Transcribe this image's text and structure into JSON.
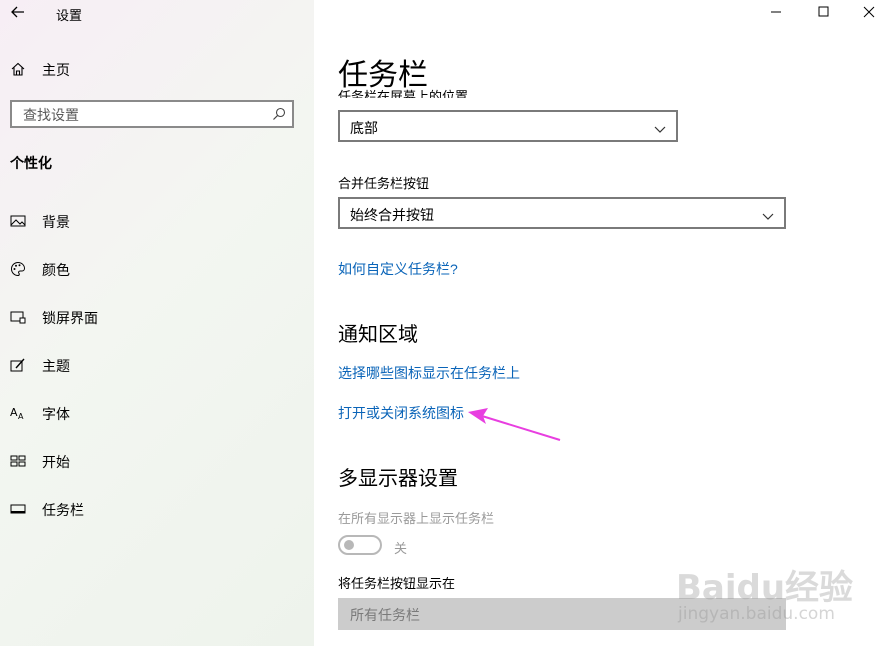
{
  "window": {
    "app_title": "设置",
    "controls": [
      "minimize-icon",
      "maximize-icon",
      "close-icon"
    ]
  },
  "sidebar": {
    "home_label": "主页",
    "search_placeholder": "查找设置",
    "section_title": "个性化",
    "items": [
      {
        "label": "背景",
        "icon": "picture-icon"
      },
      {
        "label": "颜色",
        "icon": "palette-icon"
      },
      {
        "label": "锁屏界面",
        "icon": "lockscreen-icon"
      },
      {
        "label": "主题",
        "icon": "theme-icon"
      },
      {
        "label": "字体",
        "icon": "font-icon"
      },
      {
        "label": "开始",
        "icon": "start-icon"
      },
      {
        "label": "任务栏",
        "icon": "taskbar-icon"
      }
    ]
  },
  "main": {
    "page_title": "任务栏",
    "position_label": "任务栏在屏幕上的位置",
    "position_value": "底部",
    "combine_label": "合并任务栏按钮",
    "combine_value": "始终合并按钮",
    "customize_link": "如何自定义任务栏?",
    "notification_title": "通知区域",
    "select_icons_link": "选择哪些图标显示在任务栏上",
    "system_icons_link": "打开或关闭系统图标",
    "multi_display_title": "多显示器设置",
    "show_all_label": "在所有显示器上显示任务栏",
    "toggle_state": "关",
    "show_buttons_label": "将任务栏按钮显示在",
    "show_buttons_value": "所有任务栏"
  },
  "colors": {
    "link": "#0a64b8",
    "annotation_arrow": "#e83ee0"
  },
  "watermark": {
    "brand": "Baidu经验",
    "url": "jingyan.baidu.com"
  }
}
